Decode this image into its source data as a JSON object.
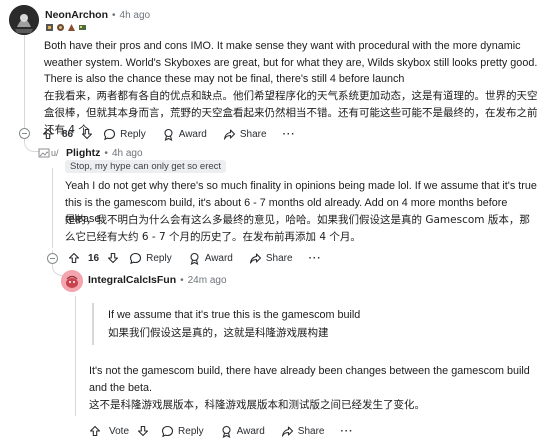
{
  "comment1": {
    "author": "NeonArchon",
    "separator": "•",
    "time": "4h ago",
    "flair_text": "🎮🎮🎮🎮",
    "body_en": "Both have their pros and cons IMO. It make sense they want with procedural with the more dynamic weather system. World's Skyboxes are great, but for what they are, Wilds skybox still looks pretty good. There is also the chance these may not be final, there's still 4 before launch",
    "body_zh": "在我看来，两者都有各自的优点和缺点。他们希望程序化的天气系统更加动态，这是有道理的。世界的天空盒很棒，但就其本身而言，荒野的天空盒看起来仍然相当不错。还有可能这些可能不是最终的，在发布之前还有 4 个",
    "votes": "86",
    "reply": "Reply",
    "award": "Award",
    "share": "Share",
    "more": "···"
  },
  "comment2": {
    "avatar_alt": "u/",
    "author": "Plightz",
    "separator": "•",
    "time": "4h ago",
    "flair": "Stop, my hype can only get so erect",
    "body_en": "Yeah I do not get why there's so much finality in opinions being made lol. If we assume that it's true this is the gamescom build, it's about 6 - 7 months old already. Add on 4 more months before release.",
    "body_zh": "是的，我不明白为什么会有这么多最终的意见，哈哈。如果我们假设这是真的 Gamescom 版本，那么它已经有大约 6 - 7 个月的历史了。在发布前再添加 4 个月。",
    "votes": "16",
    "reply": "Reply",
    "award": "Award",
    "share": "Share",
    "more": "···"
  },
  "comment3": {
    "author": "IntegralCalcIsFun",
    "separator": "•",
    "time": "24m ago",
    "quote_en": "If we assume that it's true this is the gamescom build",
    "quote_zh": "如果我们假设这是真的，这就是科隆游戏展构建",
    "body_en": "It's not the gamescom build, there have already been changes between the gamescom build and the beta.",
    "body_zh": "这不是科隆游戏展版本，科隆游戏展版本和测试版之间已经发生了变化。",
    "vote_label": "Vote",
    "reply": "Reply",
    "award": "Award",
    "share": "Share",
    "more": "···"
  },
  "colors": {
    "neon_avatar": "#2a2a2a",
    "integral_avatar": "#f2a0a8",
    "thread_line": "#d6d9dc"
  }
}
